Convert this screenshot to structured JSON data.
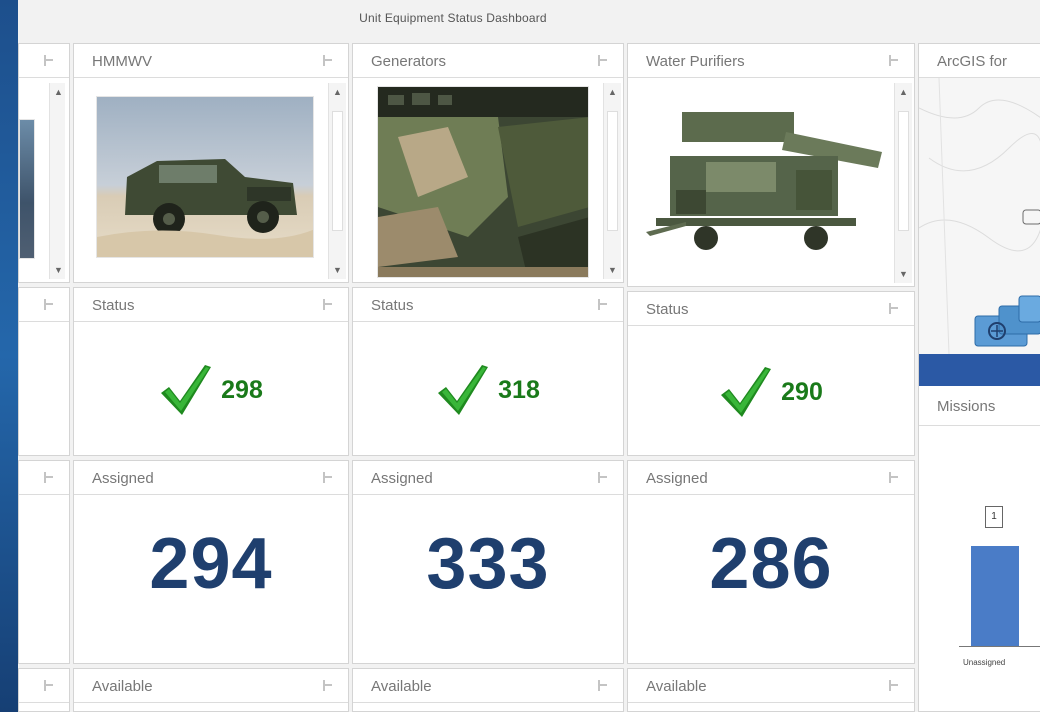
{
  "dashboard": {
    "title": "Unit Equipment Status Dashboard"
  },
  "columns": [
    {
      "name": "HMMWV",
      "status_label": "Status",
      "status_value": "298",
      "assigned_label": "Assigned",
      "assigned_value": "294",
      "available_label": "Available"
    },
    {
      "name": "Generators",
      "status_label": "Status",
      "status_value": "318",
      "assigned_label": "Assigned",
      "assigned_value": "333",
      "available_label": "Available"
    },
    {
      "name": "Water Purifiers",
      "status_label": "Status",
      "status_value": "290",
      "assigned_label": "Assigned",
      "assigned_value": "286",
      "available_label": "Available"
    }
  ],
  "right_panel": {
    "map_title": "ArcGIS for",
    "missions_title": "Missions",
    "chart_data": {
      "type": "bar",
      "categories": [
        "Unassigned"
      ],
      "values": [
        1
      ],
      "title": "",
      "xlabel": "",
      "ylabel": ""
    }
  },
  "colors": {
    "accent_blue": "#2b59a5",
    "assigned_number": "#1f3f6e",
    "status_green": "#1a7a1a"
  }
}
